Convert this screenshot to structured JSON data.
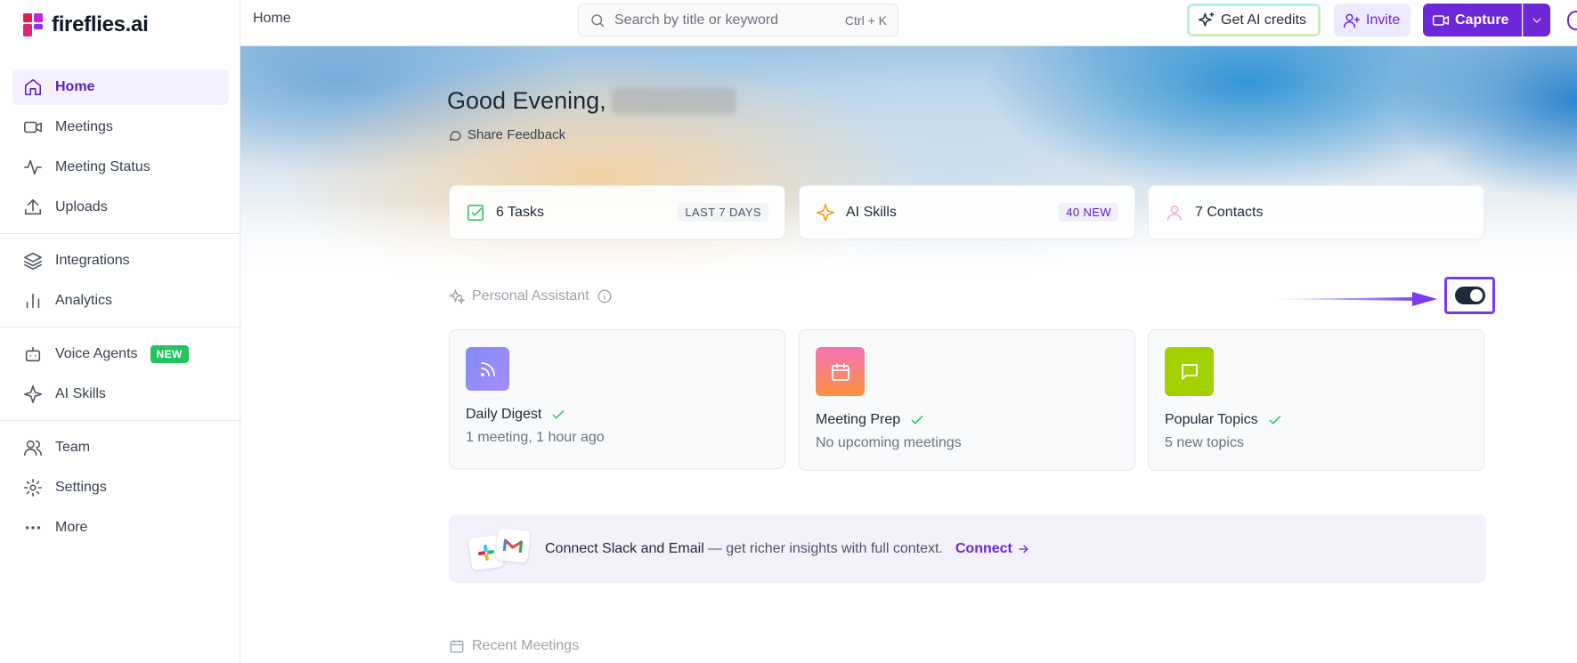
{
  "app": {
    "name": "fireflies.ai"
  },
  "sidebar": {
    "items": [
      {
        "label": "Home"
      },
      {
        "label": "Meetings"
      },
      {
        "label": "Meeting Status"
      },
      {
        "label": "Uploads"
      },
      {
        "label": "Integrations"
      },
      {
        "label": "Analytics"
      },
      {
        "label": "Voice Agents",
        "badge": "NEW"
      },
      {
        "label": "AI Skills"
      },
      {
        "label": "Team"
      },
      {
        "label": "Settings"
      },
      {
        "label": "More"
      }
    ],
    "active": "Home"
  },
  "topbar": {
    "breadcrumb": "Home",
    "search_placeholder": "Search by title or keyword",
    "search_shortcut": "Ctrl + K",
    "credits_label": "Get AI credits",
    "invite_label": "Invite",
    "capture_label": "Capture"
  },
  "hero": {
    "greeting": "Good Evening,",
    "feedback_label": "Share Feedback"
  },
  "stats": [
    {
      "label": "6 Tasks",
      "tag": "LAST 7 DAYS"
    },
    {
      "label": "AI Skills",
      "tag": "40 NEW"
    },
    {
      "label": "7 Contacts"
    }
  ],
  "assistant": {
    "title": "Personal Assistant",
    "enabled": true,
    "cards": [
      {
        "title": "Daily Digest",
        "subtitle": "1 meeting, 1 hour ago"
      },
      {
        "title": "Meeting Prep",
        "subtitle": "No upcoming meetings"
      },
      {
        "title": "Popular Topics",
        "subtitle": "5 new topics"
      }
    ]
  },
  "connect": {
    "title": "Connect Slack and Email",
    "text": "— get richer insights with full context.",
    "link_label": "Connect"
  },
  "recent": {
    "title": "Recent Meetings"
  },
  "colors": {
    "accent": "#6d28d9",
    "success": "#22c55e"
  }
}
